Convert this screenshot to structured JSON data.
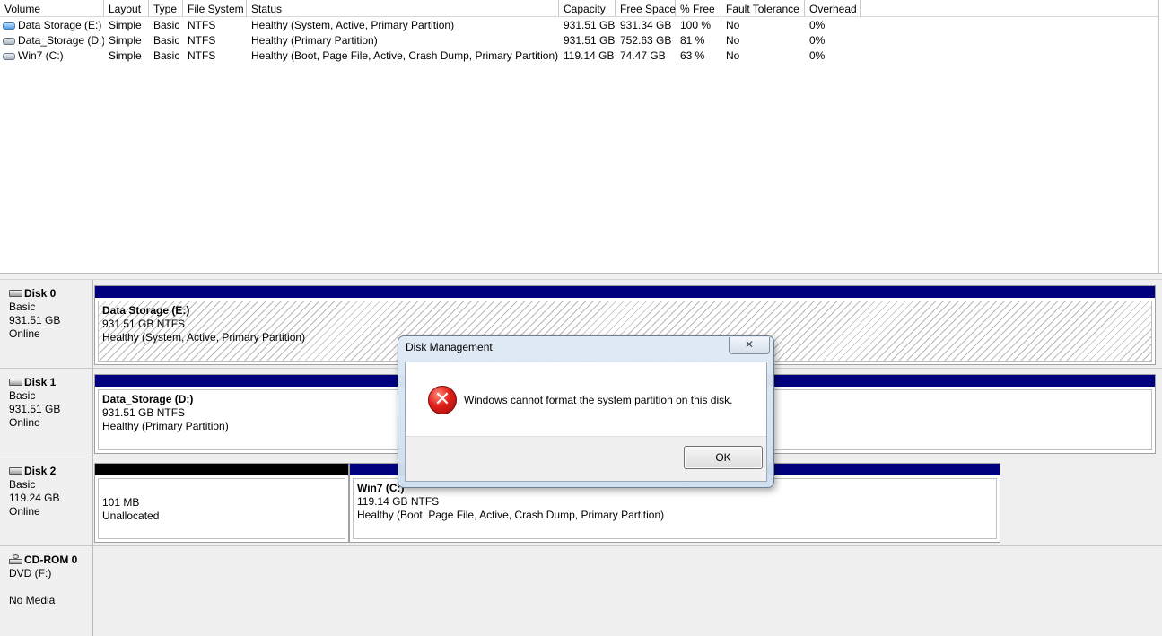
{
  "volume_list": {
    "columns": [
      "Volume",
      "Layout",
      "Type",
      "File System",
      "Status",
      "Capacity",
      "Free Space",
      "% Free",
      "Fault Tolerance",
      "Overhead"
    ],
    "rows": [
      {
        "volume": "Data Storage (E:)",
        "layout": "Simple",
        "type": "Basic",
        "fs": "NTFS",
        "status": "Healthy (System, Active, Primary Partition)",
        "capacity": "931.51 GB",
        "free": "931.34 GB",
        "pct_free": "100 %",
        "fault": "No",
        "overhead": "0%",
        "icon": "blue-volume-icon"
      },
      {
        "volume": "Data_Storage (D:)",
        "layout": "Simple",
        "type": "Basic",
        "fs": "NTFS",
        "status": "Healthy (Primary Partition)",
        "capacity": "931.51 GB",
        "free": "752.63 GB",
        "pct_free": "81 %",
        "fault": "No",
        "overhead": "0%",
        "icon": "volume-icon"
      },
      {
        "volume": "Win7 (C:)",
        "layout": "Simple",
        "type": "Basic",
        "fs": "NTFS",
        "status": "Healthy (Boot, Page File, Active, Crash Dump, Primary Partition)",
        "capacity": "119.14 GB",
        "free": "74.47 GB",
        "pct_free": "63 %",
        "fault": "No",
        "overhead": "0%",
        "icon": "volume-icon"
      }
    ]
  },
  "disks": [
    {
      "name": "Disk 0",
      "type": "Basic",
      "size": "931.51 GB",
      "status": "Online",
      "partitions": [
        {
          "name": "Data Storage  (E:)",
          "size": "931.51 GB NTFS",
          "status": "Healthy (System, Active, Primary Partition)"
        }
      ]
    },
    {
      "name": "Disk 1",
      "type": "Basic",
      "size": "931.51 GB",
      "status": "Online",
      "partitions": [
        {
          "name": "Data_Storage  (D:)",
          "size": "931.51 GB NTFS",
          "status": "Healthy (Primary Partition)"
        }
      ]
    },
    {
      "name": "Disk 2",
      "type": "Basic",
      "size": "119.24 GB",
      "status": "Online",
      "partitions": [
        {
          "name": "",
          "size": "101 MB",
          "status": "Unallocated"
        },
        {
          "name": "Win7  (C:)",
          "size": "119.14 GB NTFS",
          "status": "Healthy (Boot, Page File, Active, Crash Dump, Primary Partition)"
        }
      ]
    },
    {
      "name": "CD-ROM 0",
      "type": "DVD (F:)",
      "size": "",
      "status": "No Media",
      "partitions": []
    }
  ],
  "dialog": {
    "title": "Disk Management",
    "close_label": "✕",
    "icon": "error-icon",
    "message": "Windows cannot format the system partition on this disk.",
    "ok_label": "OK"
  },
  "colors": {
    "partition_bar": "#00007f",
    "unallocated_bar": "#000000",
    "error": "#e0201a"
  }
}
